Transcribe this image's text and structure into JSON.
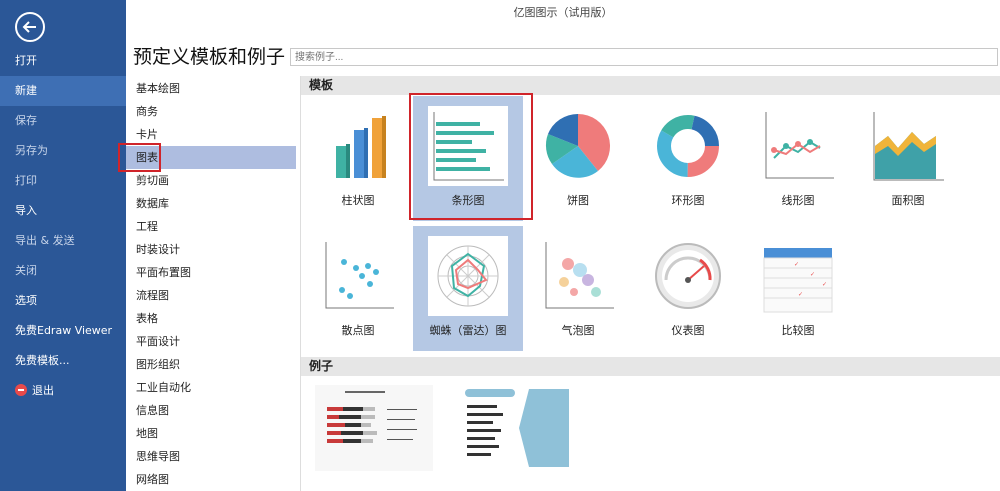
{
  "window_title": "亿图图示（试用版）",
  "sidebar": {
    "items": [
      {
        "label": "打开"
      },
      {
        "label": "新建"
      },
      {
        "label": "保存"
      },
      {
        "label": "另存为"
      },
      {
        "label": "打印"
      },
      {
        "label": "导入"
      },
      {
        "label": "导出 & 发送"
      },
      {
        "label": "关闭"
      },
      {
        "label": "选项"
      },
      {
        "label": "免费Edraw Viewer"
      },
      {
        "label": "免费模板..."
      },
      {
        "label": "退出"
      }
    ]
  },
  "page_title": "预定义模板和例子",
  "search": {
    "placeholder": "搜索例子..."
  },
  "categories": [
    "基本绘图",
    "商务",
    "卡片",
    "图表",
    "剪切画",
    "数据库",
    "工程",
    "时装设计",
    "平面布置图",
    "流程图",
    "表格",
    "平面设计",
    "图形组织",
    "工业自动化",
    "信息图",
    "地图",
    "思维导图",
    "网络图"
  ],
  "selected_category": "图表",
  "templates_heading": "模板",
  "templates": [
    {
      "label": "柱状图",
      "icon": "bar-chart-3d-icon"
    },
    {
      "label": "条形图",
      "icon": "horizontal-bar-chart-icon"
    },
    {
      "label": "饼图",
      "icon": "pie-chart-icon"
    },
    {
      "label": "环形图",
      "icon": "donut-chart-icon"
    },
    {
      "label": "线形图",
      "icon": "line-chart-icon"
    },
    {
      "label": "面积图",
      "icon": "area-chart-icon"
    },
    {
      "label": "散点图",
      "icon": "scatter-chart-icon"
    },
    {
      "label": "蜘蛛（雷达）图",
      "icon": "radar-chart-icon"
    },
    {
      "label": "气泡图",
      "icon": "bubble-chart-icon"
    },
    {
      "label": "仪表图",
      "icon": "gauge-chart-icon"
    },
    {
      "label": "比较图",
      "icon": "comparison-chart-icon"
    }
  ],
  "selected_template": "条形图",
  "examples_heading": "例子",
  "colors": {
    "sidebar": "#2b5797",
    "accent_red": "#d0242a",
    "selected": "#b5c8e4"
  }
}
